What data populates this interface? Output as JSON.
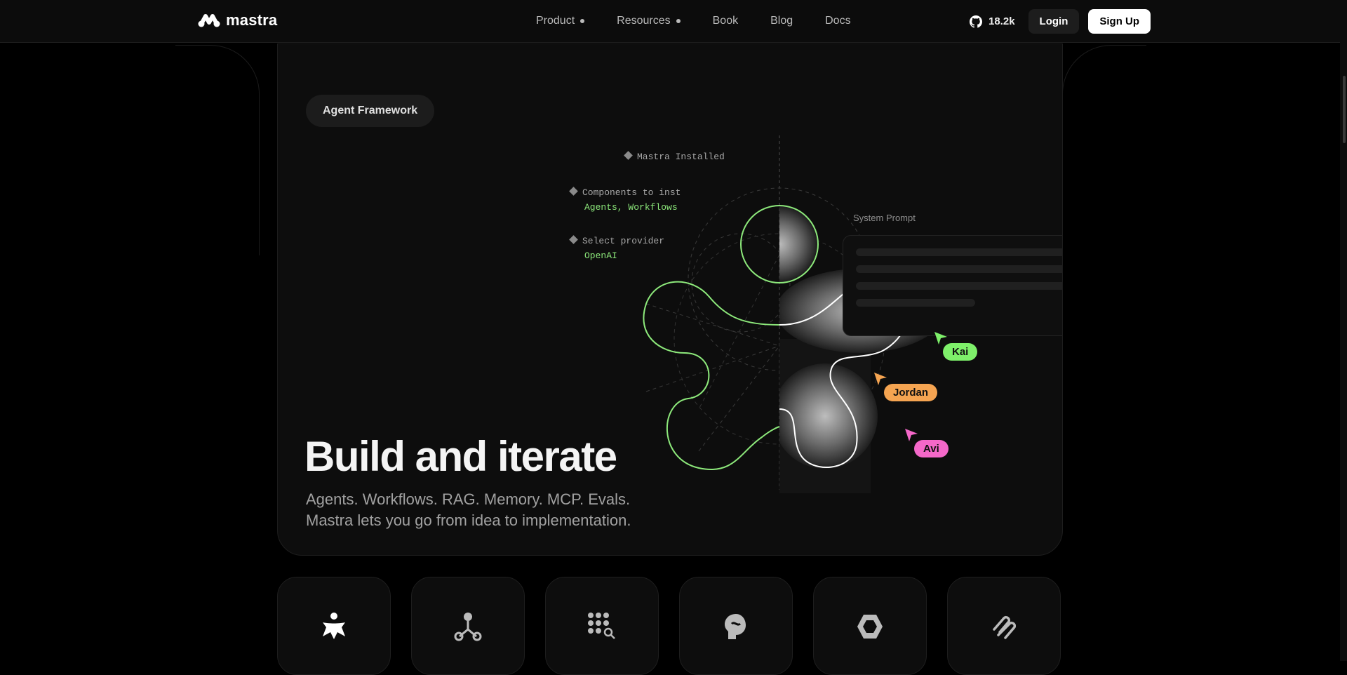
{
  "brand": {
    "name": "mastra"
  },
  "nav": {
    "items": [
      {
        "label": "Product",
        "has_dropdown": true
      },
      {
        "label": "Resources",
        "has_dropdown": true
      },
      {
        "label": "Book",
        "has_dropdown": false
      },
      {
        "label": "Blog",
        "has_dropdown": false
      },
      {
        "label": "Docs",
        "has_dropdown": false
      }
    ],
    "github_stars": "18.2k",
    "login_label": "Login",
    "signup_label": "Sign Up"
  },
  "hero": {
    "tag": "Agent Framework",
    "title": "Build and iterate",
    "subtitle_line1": "Agents. Workflows. RAG. Memory. MCP. Evals.",
    "subtitle_line2": "Mastra lets you go from idea to implementation."
  },
  "setup_steps": [
    {
      "label": "Mastra Installed",
      "value": ""
    },
    {
      "label": "Components to inst",
      "value": "Agents, Workflows"
    },
    {
      "label": "Select provider",
      "value": "OpenAI"
    }
  ],
  "system_prompt": {
    "label": "System Prompt"
  },
  "collaborators": [
    {
      "name": "Kai",
      "color": "#7ef06a"
    },
    {
      "name": "Jordan",
      "color": "#f5a451"
    },
    {
      "name": "Avi",
      "color": "#f468c9"
    }
  ],
  "colors": {
    "accent_green": "#8de97b",
    "background": "#000000",
    "panel": "#0d0d0d"
  },
  "feature_tiles": [
    {
      "icon": "agent-icon"
    },
    {
      "icon": "workflow-icon"
    },
    {
      "icon": "rag-icon"
    },
    {
      "icon": "memory-icon"
    },
    {
      "icon": "mcp-icon"
    },
    {
      "icon": "evals-icon"
    }
  ]
}
